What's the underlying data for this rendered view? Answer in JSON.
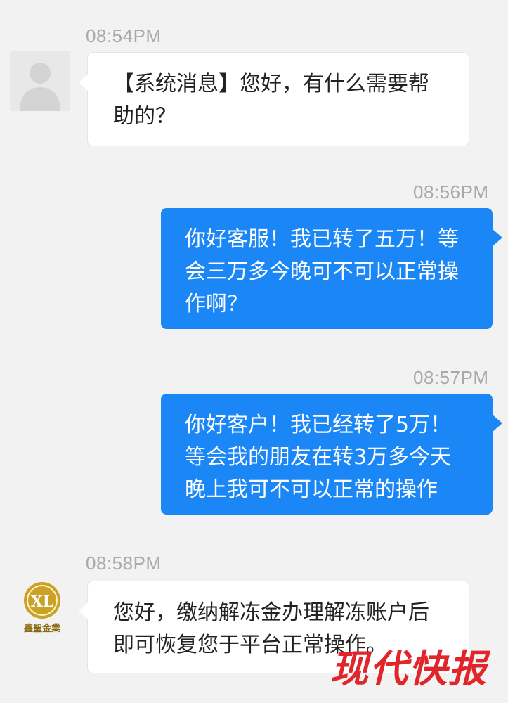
{
  "messages": [
    {
      "time": "08:54PM",
      "direction": "incoming",
      "avatar": "default-avatar",
      "lines": [
        "【系统消息】您好，有什么需要帮",
        "助的？"
      ]
    },
    {
      "time": "08:56PM",
      "direction": "outgoing",
      "lines": [
        "你好客服！我已转了五万！等",
        "会三万多今晚可不可以正常操",
        "作啊？"
      ]
    },
    {
      "time": "08:57PM",
      "direction": "outgoing",
      "lines": [
        "你好客户！我已经转了5万！",
        "等会我的朋友在转3万多今天",
        "晚上我可不可以正常的操作"
      ]
    },
    {
      "time": "08:58PM",
      "direction": "incoming",
      "avatar": "brand-logo",
      "avatar_caption": "鑫聖金業",
      "lines": [
        "您好，缴纳解冻金办理解冻账户后",
        "即可恢复您于平台正常操作。"
      ]
    }
  ],
  "watermark": "现代快报",
  "colors": {
    "background": "#f2f2f2",
    "outgoing_bubble": "#1b86f5",
    "incoming_bubble": "#ffffff",
    "timestamp": "#a9a9a9",
    "brand_gold": "#c9a227",
    "watermark": "#e0262a"
  }
}
